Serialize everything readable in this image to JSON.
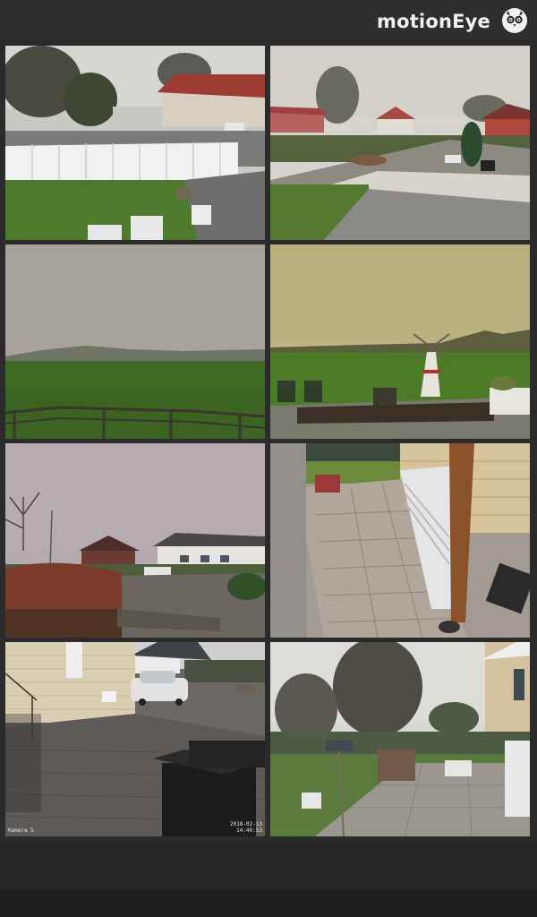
{
  "app": {
    "title": "motionEye",
    "logo_icon": "motioneye-owl-icon"
  },
  "colors": {
    "header_bg": "#2e2e2e",
    "page_bg": "#2b2b2b",
    "title_text": "#f2f2f2"
  },
  "cameras": [
    {
      "id": "cam-1",
      "scene": "house-white-fence-lawn",
      "name": "",
      "timestamp": ""
    },
    {
      "id": "cam-2",
      "scene": "rural-road-with-houses",
      "name": "",
      "timestamp": ""
    },
    {
      "id": "cam-3",
      "scene": "foggy-field-with-fence",
      "name": "",
      "timestamp": ""
    },
    {
      "id": "cam-4",
      "scene": "field-with-windmill-ornament",
      "name": "",
      "timestamp": ""
    },
    {
      "id": "cam-5",
      "scene": "street-houses-hedge",
      "name": "",
      "timestamp": ""
    },
    {
      "id": "cam-6",
      "scene": "patio-downward-view",
      "name": "",
      "timestamp": ""
    },
    {
      "id": "cam-7",
      "scene": "driveway-car-bins",
      "name": "Kamera 5",
      "timestamp": "2018-02-13\n14:40:53"
    },
    {
      "id": "cam-8",
      "scene": "garden-with-trees-patio",
      "name": "",
      "timestamp": ""
    }
  ]
}
